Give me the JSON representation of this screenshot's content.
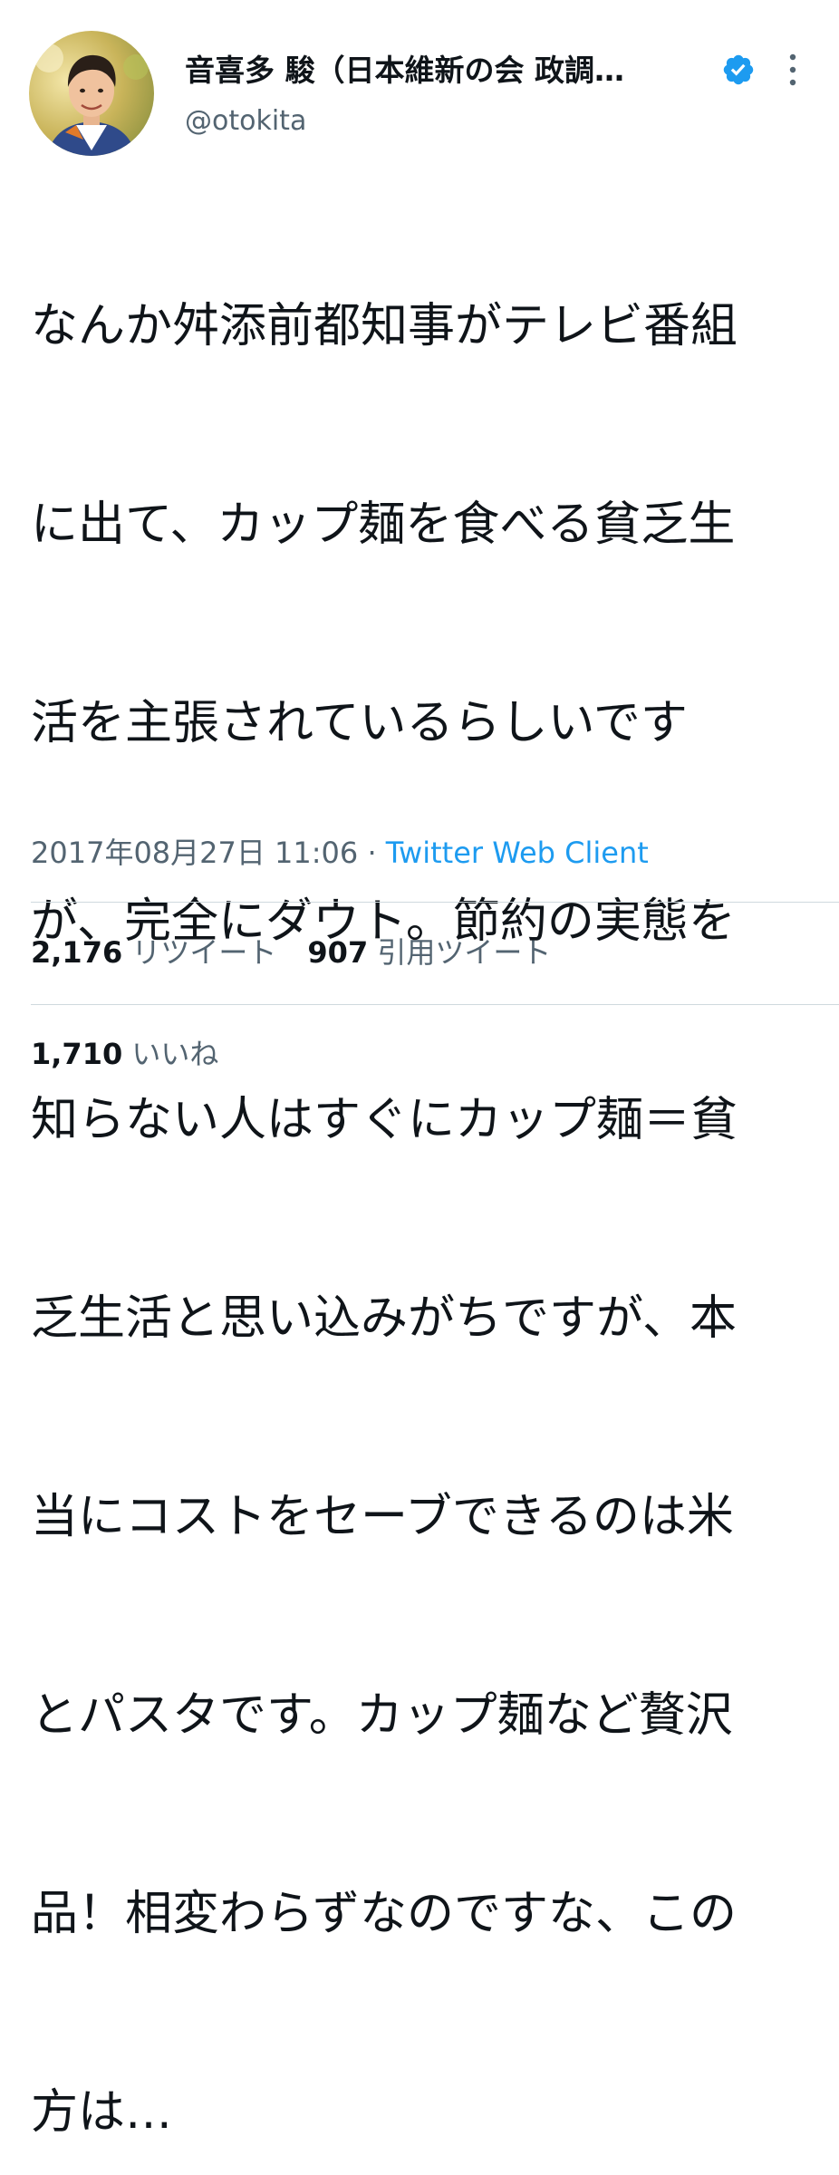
{
  "author": {
    "display_name": "音喜多 駿（日本維新の会 政調…",
    "handle": "@otokita",
    "avatar": "profile-photo",
    "verified_icon": "verified-badge-icon",
    "more_icon": "more-vertical-icon"
  },
  "tweet": {
    "lines": [
      "なんか舛添前都知事がテレビ番組",
      "に出て、カップ麺を食べる貧乏生",
      "活を主張されているらしいです",
      "が、完全にダウト。節約の実態を",
      "知らない人はすぐにカップ麺＝貧",
      "乏生活と思い込みがちですが、本",
      "当にコストをセーブできるのは米",
      "とパスタです。カップ麺など贅沢",
      "品！相変わらずなのですな、この",
      "方は…"
    ]
  },
  "meta": {
    "datetime": "2017年08月27日 11:06",
    "separator": " · ",
    "source": "Twitter Web Client"
  },
  "stats": {
    "retweets_count": "2,176",
    "retweets_label": "リツイート",
    "quotes_count": "907",
    "quotes_label": "引用ツイート",
    "likes_count": "1,710",
    "likes_label": "いいね"
  },
  "colors": {
    "text": "#0f1419",
    "secondary": "#536471",
    "link": "#1d9bf0",
    "divider": "#cfd9de",
    "verified": "#1d9bf0"
  }
}
